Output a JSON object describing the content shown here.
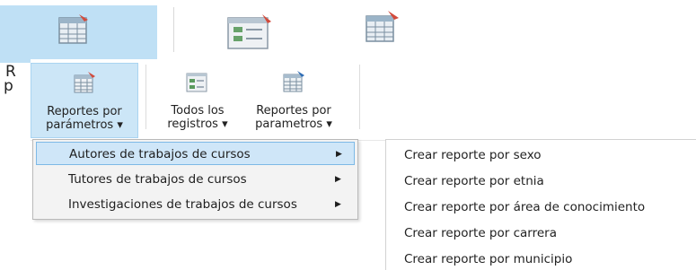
{
  "background": {
    "left_label_line1": "R",
    "left_label_line2": "p",
    "icons": [
      "report-grid-icon",
      "records-list-icon",
      "report-grid-icon"
    ]
  },
  "ribbon": {
    "buttons": [
      {
        "label": "Reportes por\nparámetros ▾",
        "icon": "report-params-icon"
      },
      {
        "label": "Todos los\nregistros ▾",
        "icon": "all-records-icon"
      },
      {
        "label": "Reportes por\nparametros ▾",
        "icon": "report-params-icon"
      }
    ]
  },
  "menu": {
    "items": [
      {
        "label": "Autores de trabajos de cursos",
        "arrow": "▶",
        "highlighted": true
      },
      {
        "label": "Tutores de trabajos de cursos",
        "arrow": "▶",
        "highlighted": false
      },
      {
        "label": "Investigaciones de trabajos de cursos",
        "arrow": "▶",
        "highlighted": false
      }
    ]
  },
  "submenu": {
    "items": [
      {
        "label": "Crear reporte por sexo"
      },
      {
        "label": "Crear reporte por etnia"
      },
      {
        "label": "Crear reporte por área de conocimiento"
      },
      {
        "label": "Crear reporte por carrera"
      },
      {
        "label": "Crear reporte por municipio"
      }
    ]
  },
  "colors": {
    "highlight_bg": "#cfe6f8",
    "highlight_border": "#7db9e6",
    "active_button_bg": "#cce6f7"
  }
}
